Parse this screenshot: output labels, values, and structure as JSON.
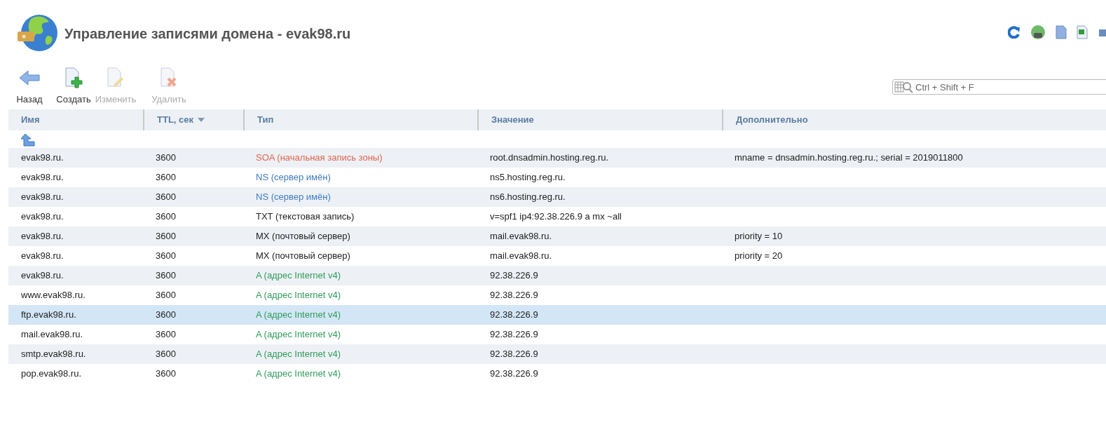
{
  "title": "Управление записями домена - evak98.ru",
  "toolbar": [
    {
      "label": "Назад",
      "kind": "back",
      "disabled": false
    },
    {
      "label": "Создать",
      "kind": "create",
      "disabled": false
    },
    {
      "label": "Изменить",
      "kind": "edit",
      "disabled": true
    },
    {
      "label": "Удалить",
      "kind": "delete",
      "disabled": true
    }
  ],
  "search": {
    "placeholder": "Ctrl + Shift + F"
  },
  "table": {
    "columns": [
      {
        "label": "Имя",
        "sorted": false
      },
      {
        "label": "TTL, сек",
        "sorted": true
      },
      {
        "label": "Тип",
        "sorted": false
      },
      {
        "label": "Значение",
        "sorted": false
      },
      {
        "label": "Дополнительно",
        "sorted": false
      }
    ],
    "rows": [
      {
        "name": "evak98.ru.",
        "ttl": "3600",
        "type": "SOA (начальная запись зоны)",
        "color": "#e0654f",
        "value": "root.dnsadmin.hosting.reg.ru.",
        "extra": "mname = dnsadmin.hosting.reg.ru.; serial = 2019011800",
        "selected": false
      },
      {
        "name": "evak98.ru.",
        "ttl": "3600",
        "type": "NS (сервер имён)",
        "color": "#3f7cbf",
        "value": "ns5.hosting.reg.ru.",
        "extra": "",
        "selected": false
      },
      {
        "name": "evak98.ru.",
        "ttl": "3600",
        "type": "NS (сервер имён)",
        "color": "#3f7cbf",
        "value": "ns6.hosting.reg.ru.",
        "extra": "",
        "selected": false
      },
      {
        "name": "evak98.ru.",
        "ttl": "3600",
        "type": "TXT (текстовая запись)",
        "color": "#222222",
        "value": "v=spf1 ip4:92.38.226.9 a mx ~all",
        "extra": "",
        "selected": false
      },
      {
        "name": "evak98.ru.",
        "ttl": "3600",
        "type": "MX (почтовый сервер)",
        "color": "#222222",
        "value": "mail.evak98.ru.",
        "extra": "priority = 10",
        "selected": false
      },
      {
        "name": "evak98.ru.",
        "ttl": "3600",
        "type": "MX (почтовый сервер)",
        "color": "#222222",
        "value": "mail.evak98.ru.",
        "extra": "priority = 20",
        "selected": false
      },
      {
        "name": "evak98.ru.",
        "ttl": "3600",
        "type": "A (адрес Internet v4)",
        "color": "#2f9c5a",
        "value": "92.38.226.9",
        "extra": "",
        "selected": false
      },
      {
        "name": "www.evak98.ru.",
        "ttl": "3600",
        "type": "A (адрес Internet v4)",
        "color": "#2f9c5a",
        "value": "92.38.226.9",
        "extra": "",
        "selected": false
      },
      {
        "name": "ftp.evak98.ru.",
        "ttl": "3600",
        "type": "A (адрес Internet v4)",
        "color": "#2f9c5a",
        "value": "92.38.226.9",
        "extra": "",
        "selected": true
      },
      {
        "name": "mail.evak98.ru.",
        "ttl": "3600",
        "type": "A (адрес Internet v4)",
        "color": "#2f9c5a",
        "value": "92.38.226.9",
        "extra": "",
        "selected": false
      },
      {
        "name": "smtp.evak98.ru.",
        "ttl": "3600",
        "type": "A (адрес Internet v4)",
        "color": "#2f9c5a",
        "value": "92.38.226.9",
        "extra": "",
        "selected": false
      },
      {
        "name": "pop.evak98.ru.",
        "ttl": "3600",
        "type": "A (адрес Internet v4)",
        "color": "#2f9c5a",
        "value": "92.38.226.9",
        "extra": "",
        "selected": false
      }
    ]
  }
}
